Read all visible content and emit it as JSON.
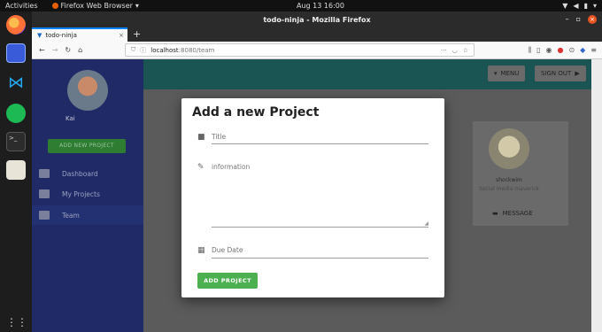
{
  "system": {
    "activities": "Activities",
    "app_name": "Firefox Web Browser",
    "clock": "Aug 13  16:00"
  },
  "browser": {
    "window_title": "todo-ninja - Mozilla Firefox",
    "tab_label": "todo-ninja",
    "url_host": "localhost",
    "url_rest": ":8080/team",
    "new_tab": "+"
  },
  "app": {
    "menu_label": "MENU",
    "signout_label": "SIGN OUT",
    "user_name": "Kai",
    "add_project_label": "ADD NEW PROJECT",
    "nav": [
      {
        "label": "Dashboard",
        "icon": "dashboard-icon"
      },
      {
        "label": "My Projects",
        "icon": "folder-icon"
      },
      {
        "label": "Team",
        "icon": "team-icon"
      }
    ],
    "team_card": {
      "name": "shockwim",
      "role": "Social media maverick",
      "message_label": "MESSAGE"
    }
  },
  "dialog": {
    "title": "Add a new Project",
    "title_placeholder": "Title",
    "info_placeholder": "information",
    "due_placeholder": "Due Date",
    "submit_label": "ADD PROJECT"
  },
  "colors": {
    "accent_green": "#4caf50",
    "drawer": "#1f2a66",
    "appbar": "#1a5553"
  }
}
